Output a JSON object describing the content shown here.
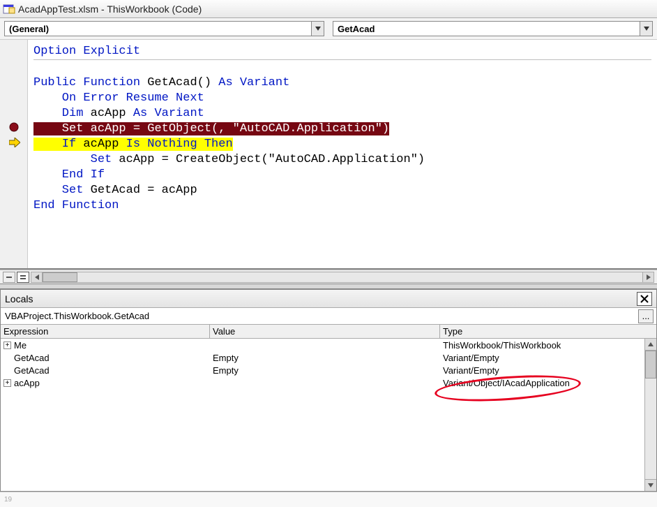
{
  "window": {
    "title": "AcadAppTest.xlsm - ThisWorkbook (Code)"
  },
  "dropdowns": {
    "object": "(General)",
    "procedure": "GetAcad"
  },
  "code": {
    "l1": "Option Explicit",
    "l3a": "Public Function",
    "l3b": " GetAcad() ",
    "l3c": "As Variant",
    "l4a": "    On Error Resume Next",
    "l5a": "    Dim",
    "l5b": " acApp ",
    "l5c": "As Variant",
    "l6a": "    Set",
    "l6b": " acApp = GetObject(, ",
    "l6c": "\"AutoCAD.Application\"",
    "l6d": ")",
    "l7a": "    If",
    "l7b": " acApp ",
    "l7c": "Is Nothing Then",
    "l8a": "        Set",
    "l8b": " acApp = CreateObject(",
    "l8c": "\"AutoCAD.Application\"",
    "l8d": ")",
    "l9": "    End If",
    "l10a": "    Set",
    "l10b": " GetAcad = acApp",
    "l11": "End Function"
  },
  "locals": {
    "title": "Locals",
    "context": "VBAProject.ThisWorkbook.GetAcad",
    "more": "...",
    "headers": {
      "expr": "Expression",
      "val": "Value",
      "type": "Type"
    },
    "rows": [
      {
        "expander": true,
        "expr": "Me",
        "val": "",
        "type": "ThisWorkbook/ThisWorkbook"
      },
      {
        "expander": false,
        "expr": "GetAcad",
        "val": "Empty",
        "type": "Variant/Empty"
      },
      {
        "expander": false,
        "expr": "GetAcad",
        "val": "Empty",
        "type": "Variant/Empty"
      },
      {
        "expander": true,
        "expr": "acApp",
        "val": "",
        "type": "Variant/Object/IAcadApplication"
      }
    ]
  },
  "sheet_tab_hint": "19"
}
